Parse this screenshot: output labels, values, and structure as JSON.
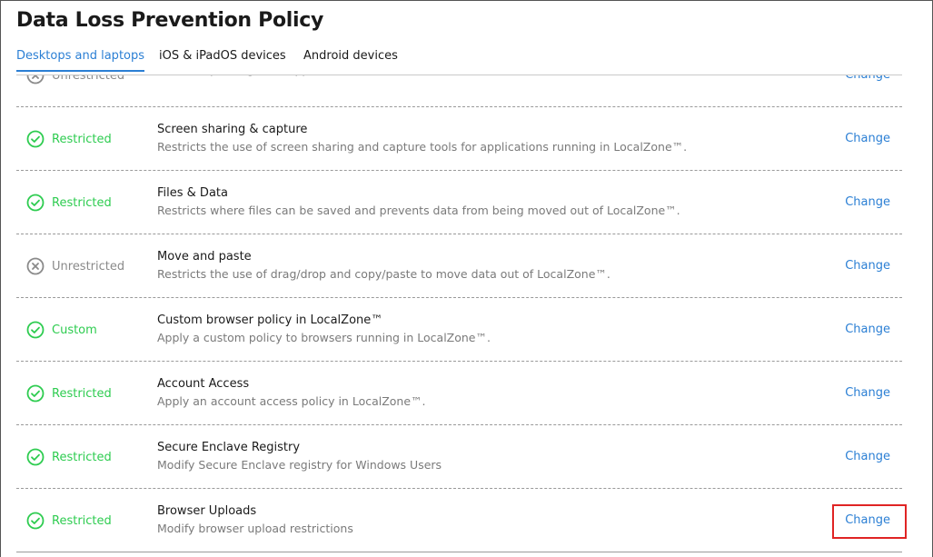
{
  "page": {
    "title": "Data Loss Prevention Policy"
  },
  "tabs": [
    {
      "label": "Desktops and laptops",
      "active": true
    },
    {
      "label": "iOS & iPadOS devices",
      "active": false
    },
    {
      "label": "Android devices",
      "active": false
    }
  ],
  "policies": [
    {
      "status": "Unrestricted",
      "status_kind": "unrestricted",
      "status_icon": "x-circle-icon",
      "name": "",
      "description": "Restricts printing from applications in LocalZone™.",
      "action": "Change"
    },
    {
      "status": "Restricted",
      "status_kind": "restricted",
      "status_icon": "check-circle-icon",
      "name": "Screen sharing & capture",
      "description": "Restricts the use of screen sharing and capture tools for applications running in LocalZone™.",
      "action": "Change"
    },
    {
      "status": "Restricted",
      "status_kind": "restricted",
      "status_icon": "check-circle-icon",
      "name": "Files & Data",
      "description": "Restricts where files can be saved and prevents data from being moved out of LocalZone™.",
      "action": "Change"
    },
    {
      "status": "Unrestricted",
      "status_kind": "unrestricted",
      "status_icon": "x-circle-icon",
      "name": "Move and paste",
      "description": "Restricts the use of drag/drop and copy/paste to move data out of LocalZone™.",
      "action": "Change"
    },
    {
      "status": "Custom",
      "status_kind": "custom",
      "status_icon": "check-circle-icon",
      "name": "Custom browser policy in LocalZone™",
      "description": "Apply a custom policy to browsers running in LocalZone™.",
      "action": "Change"
    },
    {
      "status": "Restricted",
      "status_kind": "restricted",
      "status_icon": "check-circle-icon",
      "name": "Account Access",
      "description": "Apply an account access policy in LocalZone™.",
      "action": "Change"
    },
    {
      "status": "Restricted",
      "status_kind": "restricted",
      "status_icon": "check-circle-icon",
      "name": "Secure Enclave Registry",
      "description": "Modify Secure Enclave registry for Windows Users",
      "action": "Change"
    },
    {
      "status": "Restricted",
      "status_kind": "restricted",
      "status_icon": "check-circle-icon",
      "name": "Browser Uploads",
      "description": "Modify browser upload restrictions",
      "action": "Change"
    }
  ],
  "colors": {
    "accent": "#2b7fd4",
    "restricted": "#2ecc50",
    "unrestricted": "#8a8a8a",
    "highlight": "#e02424"
  }
}
